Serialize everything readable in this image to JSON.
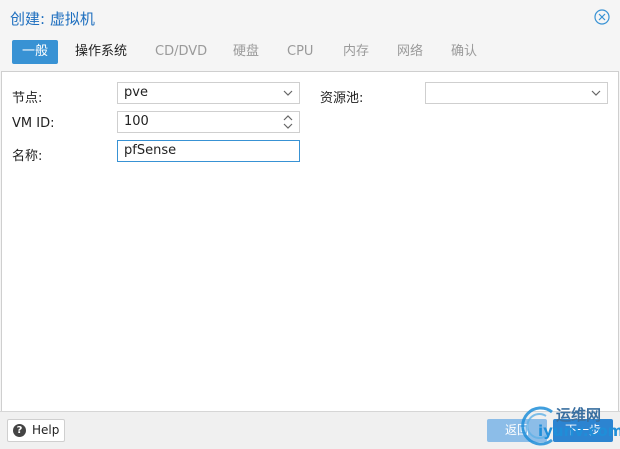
{
  "window": {
    "title": "创建: 虚拟机"
  },
  "tabs": [
    {
      "label": "一般",
      "state": "active"
    },
    {
      "label": "操作系统",
      "state": "enabled"
    },
    {
      "label": "CD/DVD",
      "state": "disabled"
    },
    {
      "label": "硬盘",
      "state": "disabled"
    },
    {
      "label": "CPU",
      "state": "disabled"
    },
    {
      "label": "内存",
      "state": "disabled"
    },
    {
      "label": "网络",
      "state": "disabled"
    },
    {
      "label": "确认",
      "state": "disabled"
    }
  ],
  "form": {
    "node": {
      "label": "节点:",
      "value": "pve"
    },
    "vmid": {
      "label": "VM ID:",
      "value": "100"
    },
    "name": {
      "label": "名称:",
      "value": "pfSense"
    },
    "pool": {
      "label": "资源池:",
      "value": ""
    }
  },
  "footer": {
    "help_label": "Help",
    "back_label": "返回",
    "next_label": "下一步"
  },
  "watermark": {
    "line1": "运维网",
    "line2": "iyunv.com"
  },
  "colors": {
    "accent": "#3892d4",
    "title": "#1e6fbf",
    "disabled_text": "#9a9a9a"
  }
}
